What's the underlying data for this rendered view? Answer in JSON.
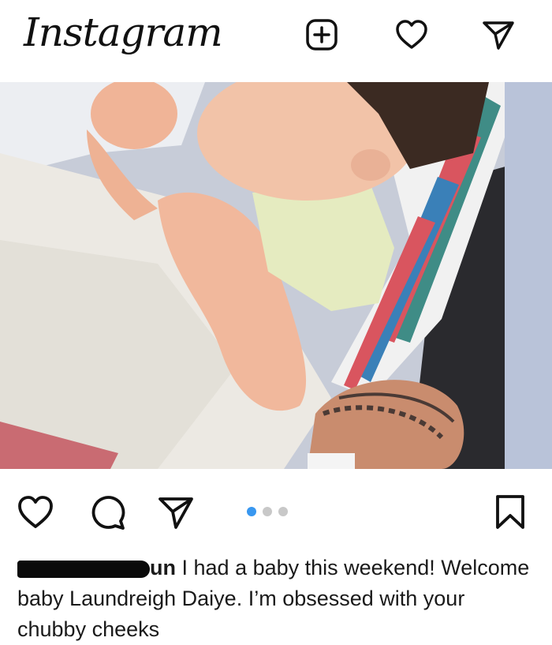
{
  "header": {
    "logo": "Instagram",
    "icons": [
      "add-post-icon",
      "heart-icon",
      "direct-message-icon"
    ]
  },
  "post": {
    "image_alt": "newborn baby wrapped in hospital blanket",
    "actions": [
      "like-icon",
      "comment-icon",
      "share-icon",
      "bookmark-icon"
    ],
    "carousel": {
      "total": 3,
      "active": 1,
      "active_color": "#3897f0"
    },
    "caption": {
      "username_visible": "un",
      "text_line1": "I had a baby this weekend!",
      "text_rest": "Welcome baby Laundreigh Daiye. I’m obsessed with your chubby cheeks"
    }
  }
}
